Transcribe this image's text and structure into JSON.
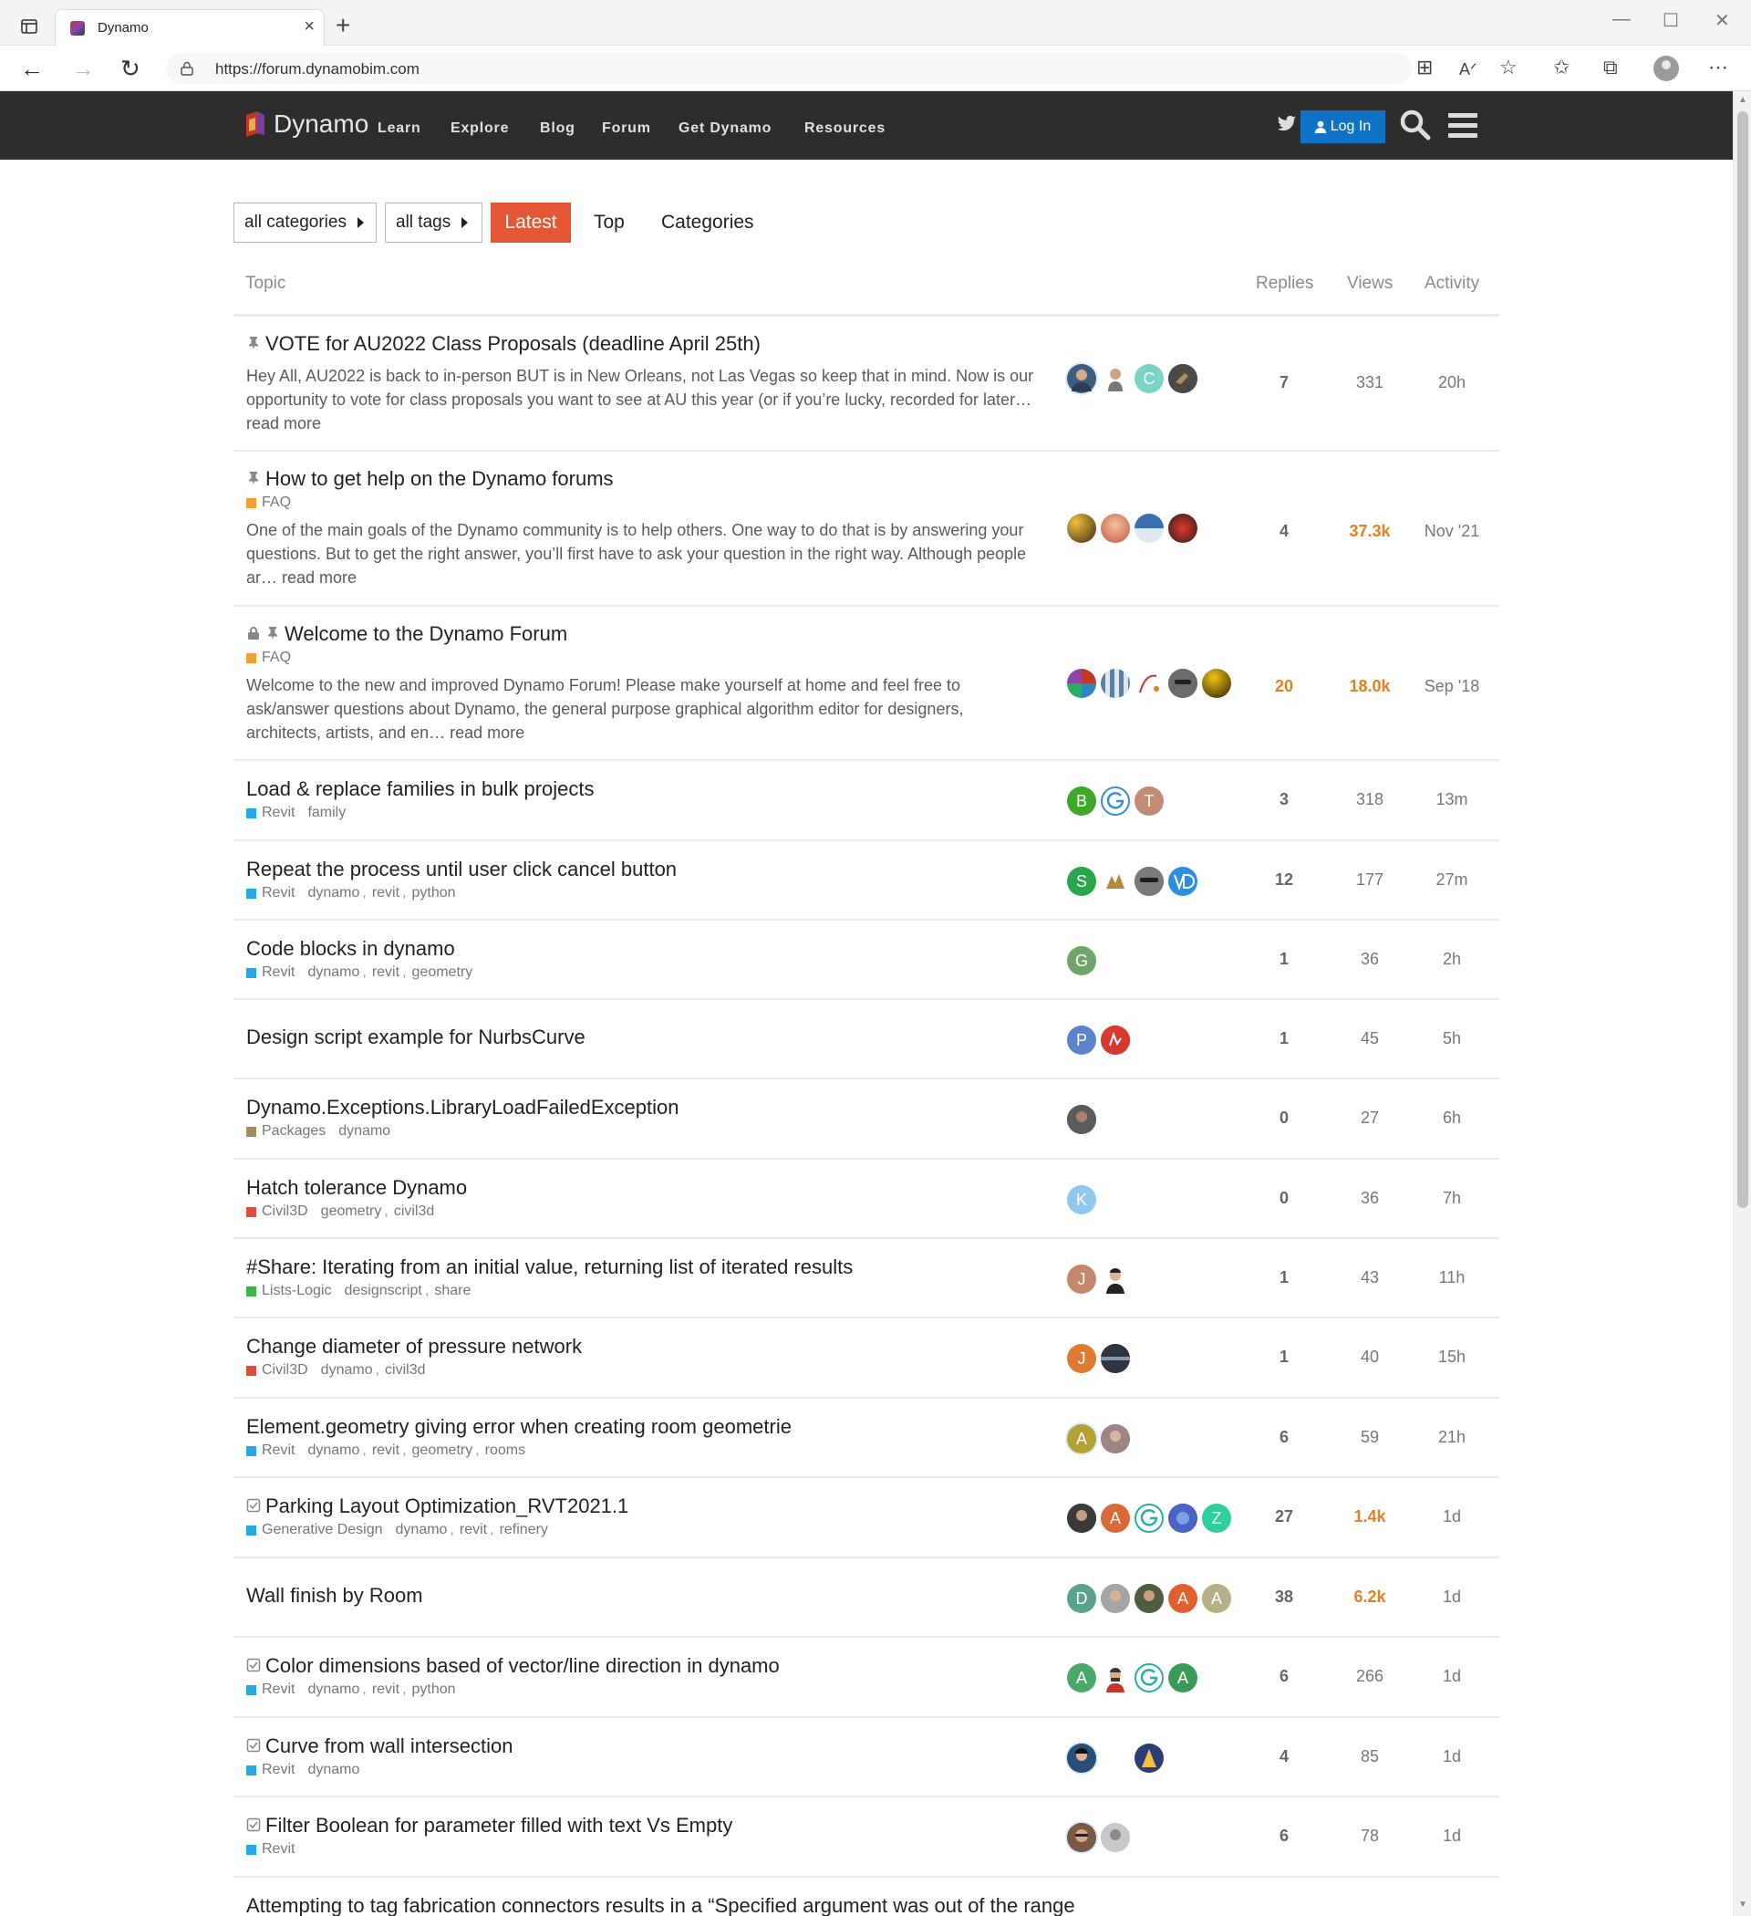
{
  "browser": {
    "tab_title": "Dynamo",
    "url": "https://forum.dynamobim.com"
  },
  "site": {
    "logo": "Dynamo",
    "nav": [
      "Learn",
      "Explore",
      "Blog",
      "Forum",
      "Get Dynamo",
      "Resources"
    ],
    "login": "Log In"
  },
  "filters": {
    "categories": "all categories",
    "tags": "all tags",
    "latest": "Latest",
    "top": "Top",
    "categories_tab": "Categories"
  },
  "columns": {
    "topic": "Topic",
    "replies": "Replies",
    "views": "Views",
    "activity": "Activity"
  },
  "colors": {
    "accent": "#e45735",
    "header_bg": "#2d2d2d",
    "login_blue": "#0f72c6",
    "hot": "#e67e22",
    "cat_faq": "#f1a035",
    "cat_revit": "#25a9e0",
    "cat_packages": "#a68c5a",
    "cat_civil3d": "#e04e39",
    "cat_lists_logic": "#3fb44a"
  },
  "topics": [
    {
      "title": "VOTE for AU2022 Class Proposals (deadline April 25th)",
      "excerpt": "Hey All, AU2022 is back to in-person BUT is in New Orleans, not Las Vegas so keep that in mind. Now is our opportunity to vote for class proposals you want to see at AU this year (or if you’re lucky, recorded for later… read more",
      "replies": "7",
      "views": "331",
      "activity": "20h"
    },
    {
      "title": "How to get help on the Dynamo forums",
      "category": "FAQ",
      "excerpt": "One of the main goals of the Dynamo community is to help others. One way to do that is by answering your questions. But to get the right answer, you’ll first have to ask your question in the right way. Although people ar… read more",
      "replies": "4",
      "views": "37.3k",
      "activity": "Nov '21"
    },
    {
      "title": "Welcome to the Dynamo Forum",
      "category": "FAQ",
      "excerpt": "Welcome to the new and improved Dynamo Forum! Please make yourself at home and feel free to ask/answer questions about Dynamo, the general purpose graphical algorithm editor for designers, architects, artists, and en… read more",
      "replies": "20",
      "views": "18.0k",
      "activity": "Sep '18"
    },
    {
      "title": "Load & replace families in bulk projects",
      "category": "Revit",
      "tags": [
        "family"
      ],
      "replies": "3",
      "views": "318",
      "activity": "13m"
    },
    {
      "title": "Repeat the process until user click cancel button",
      "category": "Revit",
      "tags": [
        "dynamo",
        "revit",
        "python"
      ],
      "replies": "12",
      "views": "177",
      "activity": "27m"
    },
    {
      "title": "Code blocks in dynamo",
      "category": "Revit",
      "tags": [
        "dynamo",
        "revit",
        "geometry"
      ],
      "replies": "1",
      "views": "36",
      "activity": "2h"
    },
    {
      "title": "Design script example for NurbsCurve",
      "replies": "1",
      "views": "45",
      "activity": "5h"
    },
    {
      "title": "Dynamo.Exceptions.LibraryLoadFailedException",
      "category": "Packages",
      "tags": [
        "dynamo"
      ],
      "replies": "0",
      "views": "27",
      "activity": "6h"
    },
    {
      "title": "Hatch tolerance Dynamo",
      "category": "Civil3D",
      "tags": [
        "geometry",
        "civil3d"
      ],
      "replies": "0",
      "views": "36",
      "activity": "7h"
    },
    {
      "title": "#Share: Iterating from an initial value, returning list of iterated results",
      "category": "Lists-Logic",
      "tags": [
        "designscript",
        "share"
      ],
      "replies": "1",
      "views": "43",
      "activity": "11h"
    },
    {
      "title": "Change diameter of pressure network",
      "category": "Civil3D",
      "tags": [
        "dynamo",
        "civil3d"
      ],
      "replies": "1",
      "views": "40",
      "activity": "15h"
    },
    {
      "title": "Element.geometry giving error when creating room geometrie",
      "category": "Revit",
      "tags": [
        "dynamo",
        "revit",
        "geometry",
        "rooms"
      ],
      "replies": "6",
      "views": "59",
      "activity": "21h"
    },
    {
      "title": "Parking Layout Optimization_RVT2021.1",
      "category": "Generative Design",
      "tags": [
        "dynamo",
        "revit",
        "refinery"
      ],
      "replies": "27",
      "views": "1.4k",
      "activity": "1d"
    },
    {
      "title": "Wall finish by Room",
      "replies": "38",
      "views": "6.2k",
      "activity": "1d"
    },
    {
      "title": "Color dimensions based of vector/line direction in dynamo",
      "category": "Revit",
      "tags": [
        "dynamo",
        "revit",
        "python"
      ],
      "replies": "6",
      "views": "266",
      "activity": "1d"
    },
    {
      "title": "Curve from wall intersection",
      "category": "Revit",
      "tags": [
        "dynamo"
      ],
      "replies": "4",
      "views": "85",
      "activity": "1d"
    },
    {
      "title": "Filter Boolean for parameter filled with text Vs Empty",
      "category": "Revit",
      "replies": "6",
      "views": "78",
      "activity": "1d"
    },
    {
      "title": "Attempting to tag fabrication connectors results in a “Specified argument was out of the range"
    }
  ],
  "avatars": {
    "r3": [
      "B",
      "",
      "T"
    ],
    "r4": [
      "S"
    ],
    "r5": [
      "G"
    ],
    "r6": [
      "P"
    ],
    "r8": [
      "K"
    ],
    "r9": [
      "J"
    ],
    "r10": [
      "J"
    ],
    "r11": [
      "A"
    ],
    "r12": [
      "",
      "A",
      "",
      "",
      "Z"
    ],
    "r13": [
      "D",
      "",
      "",
      "A",
      "A"
    ],
    "r14": [
      "A",
      "",
      "",
      "A"
    ]
  }
}
